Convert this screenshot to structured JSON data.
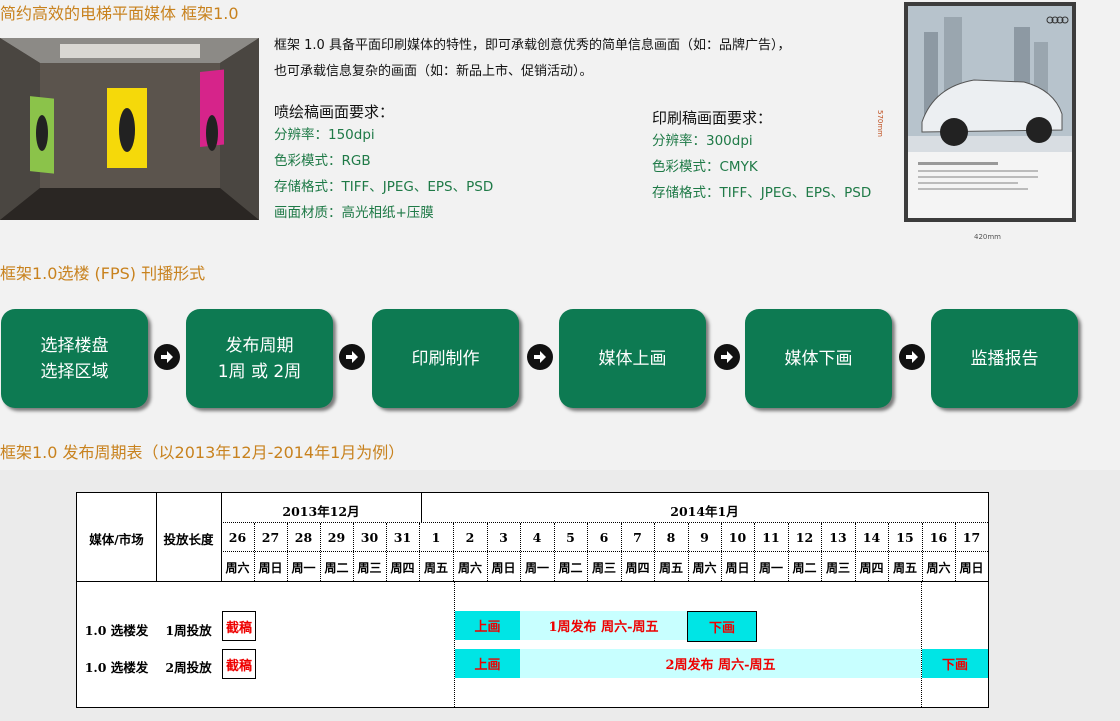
{
  "header": {
    "title": "简约高效的电梯平面媒体  框架1.0"
  },
  "intro": {
    "line1": "框架 1.0 具备平面印刷媒体的特性，即可承载创意优秀的简单信息画面（如：品牌广告），",
    "line2": "也可承载信息复杂的画面（如：新品上市、促销活动）。"
  },
  "spray": {
    "title": "喷绘稿画面要求：",
    "items": [
      "分辨率：150dpi",
      "色彩模式：RGB",
      "存储格式：TIFF、JPEG、EPS、PSD",
      "画面材质：高光相纸+压膜"
    ]
  },
  "print": {
    "title": "印刷稿画面要求：",
    "items": [
      "分辨率：300dpi",
      "色彩模式：CMYK",
      "存储格式：TIFF、JPEG、EPS、PSD"
    ]
  },
  "poster": {
    "height_label": "570mm",
    "width_label": "420mm"
  },
  "process": {
    "title": "框架1.0选楼 (FPS) 刊播形式",
    "steps": [
      {
        "line1": "选择楼盘",
        "line2": "选择区域"
      },
      {
        "line1": "发布周期",
        "line2": "1周 或 2周"
      },
      {
        "line1": "印刷制作",
        "line2": ""
      },
      {
        "line1": "媒体上画",
        "line2": ""
      },
      {
        "line1": "媒体下画",
        "line2": ""
      },
      {
        "line1": "监播报告",
        "line2": ""
      }
    ]
  },
  "schedule": {
    "title": "框架1.0 发布周期表（以2013年12月-2014年1月为例）",
    "col_media": "媒体/市场",
    "col_length": "投放长度",
    "month_dec": "2013年12月",
    "month_jan": "2014年1月",
    "days": [
      "26",
      "27",
      "28",
      "29",
      "30",
      "31",
      "1",
      "2",
      "3",
      "4",
      "5",
      "6",
      "7",
      "8",
      "9",
      "10",
      "11",
      "12",
      "13",
      "14",
      "15",
      "16",
      "17"
    ],
    "weekdays": [
      "周六",
      "周日",
      "周一",
      "周二",
      "周三",
      "周四",
      "周五",
      "周六",
      "周日",
      "周一",
      "周二",
      "周三",
      "周四",
      "周五",
      "周六",
      "周日",
      "周一",
      "周二",
      "周三",
      "周四",
      "周五",
      "周六",
      "周日"
    ],
    "rows": [
      {
        "media": "1.0 选楼发",
        "length": "1周投放",
        "deadline": "截稿",
        "up": "上画",
        "publish": "1周发布 周六-周五",
        "down": "下画"
      },
      {
        "media": "1.0 选楼发",
        "length": "2周投放",
        "deadline": "截稿",
        "up": "上画",
        "publish": "2周发布 周六-周五",
        "down": "下画"
      }
    ]
  },
  "colors": {
    "accent": "#c8821e",
    "green": "#0d7a52",
    "req_green": "#1f7a47",
    "cyan": "#00e5e5",
    "light_cyan": "#c8ffff",
    "red": "#e00000"
  }
}
